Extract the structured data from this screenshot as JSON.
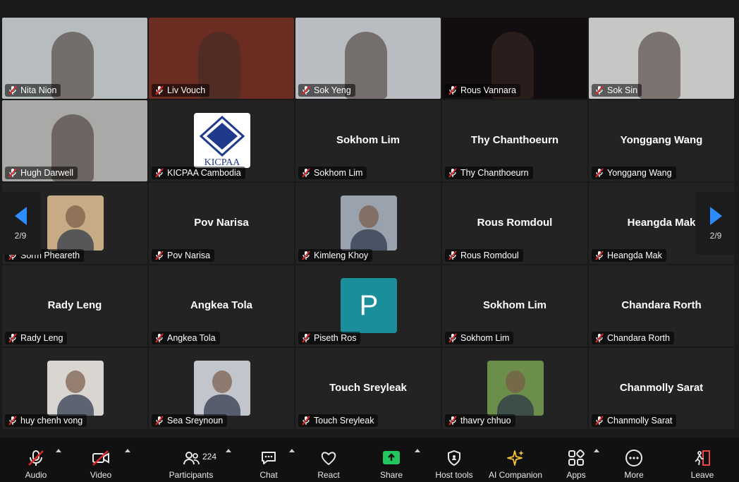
{
  "participants": [
    {
      "name": "Nita Nion",
      "big": "",
      "kind": "video",
      "bg": "#b7bcbf"
    },
    {
      "name": "Liv Vouch",
      "big": "",
      "kind": "video",
      "bg": "#6b2c22"
    },
    {
      "name": "Sok Yeng",
      "big": "",
      "kind": "video",
      "bg": "#b9bdc2"
    },
    {
      "name": "Rous Vannara",
      "big": "",
      "kind": "video",
      "bg": "#120d0e"
    },
    {
      "name": "Sok Sin",
      "big": "",
      "kind": "video",
      "bg": "#c6c7c5"
    },
    {
      "name": "Hugh Darwell",
      "big": "",
      "kind": "video",
      "bg": "#a9a9a7"
    },
    {
      "name": "KICPAA Cambodia",
      "big": "",
      "kind": "logo",
      "bg": "#232323"
    },
    {
      "name": "Sokhom Lim",
      "big": "Sokhom Lim",
      "kind": "text",
      "bg": "#232323"
    },
    {
      "name": "Thy Chanthoeurn",
      "big": "Thy Chanthoeurn",
      "kind": "text",
      "bg": "#232323"
    },
    {
      "name": "Yonggang Wang",
      "big": "Yonggang Wang",
      "kind": "text",
      "bg": "#232323"
    },
    {
      "name": "Sorm Pheareth",
      "big": "",
      "kind": "photo",
      "bg": "#232323",
      "avatar_color": "#c7ab85"
    },
    {
      "name": "Pov Narisa",
      "big": "Pov Narisa",
      "kind": "text",
      "bg": "#232323"
    },
    {
      "name": "Kimleng Khoy",
      "big": "",
      "kind": "photo",
      "bg": "#232323",
      "avatar_color": "#9aa2ad"
    },
    {
      "name": "Rous Romdoul",
      "big": "Rous Romdoul",
      "kind": "text",
      "bg": "#232323"
    },
    {
      "name": "Heangda Mak",
      "big": "Heangda Mak",
      "kind": "text",
      "bg": "#232323"
    },
    {
      "name": "Rady Leng",
      "big": "Rady Leng",
      "kind": "text",
      "bg": "#232323"
    },
    {
      "name": "Angkea Tola",
      "big": "Angkea Tola",
      "kind": "text",
      "bg": "#232323"
    },
    {
      "name": "Piseth Ros",
      "big": "",
      "kind": "letter",
      "letter": "P",
      "bg": "#232323"
    },
    {
      "name": "Sokhom Lim",
      "big": "Sokhom Lim",
      "kind": "text",
      "bg": "#232323"
    },
    {
      "name": "Chandara Rorth",
      "big": "Chandara Rorth",
      "kind": "text",
      "bg": "#232323"
    },
    {
      "name": "huy chenh vong",
      "big": "",
      "kind": "photo",
      "bg": "#232323",
      "avatar_color": "#d9d6d2"
    },
    {
      "name": "Sea Sreynoun",
      "big": "",
      "kind": "photo",
      "bg": "#232323",
      "avatar_color": "#c2c6cc"
    },
    {
      "name": "Touch Sreyleak",
      "big": "Touch Sreyleak",
      "kind": "text",
      "bg": "#232323"
    },
    {
      "name": "thavry chhuo",
      "big": "",
      "kind": "photo",
      "bg": "#232323",
      "avatar_color": "#6b8f4b"
    },
    {
      "name": "Chanmolly Sarat",
      "big": "Chanmolly Sarat",
      "kind": "text",
      "bg": "#232323"
    }
  ],
  "logo_text": "KICPAA",
  "pager": {
    "left": "2/9",
    "right": "2/9"
  },
  "toolbar": {
    "audio": "Audio",
    "video": "Video",
    "participants": "Participants",
    "participant_count": "224",
    "chat": "Chat",
    "react": "React",
    "share": "Share",
    "host_tools": "Host tools",
    "ai_companion": "AI Companion",
    "apps": "Apps",
    "more": "More",
    "leave": "Leave"
  },
  "colors": {
    "nav_arrow": "#2d8cff",
    "share_green": "#22c55e",
    "leave_red": "#ef4444",
    "mute_red": "#e02828"
  }
}
